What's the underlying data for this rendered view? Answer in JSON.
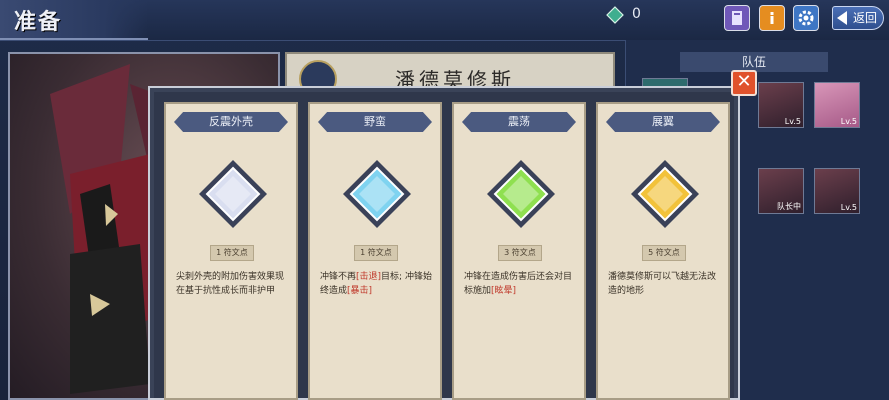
{
  "header": {
    "title": "准备",
    "gem_count": "0",
    "back_label": "返回"
  },
  "name_plate": {
    "name": "潘德莫修斯"
  },
  "team": {
    "label": "队伍",
    "slots": [
      {
        "level": "Lv.5"
      },
      {
        "level": "Lv.5"
      },
      {
        "level": "队长中"
      },
      {
        "level": "Lv.5"
      }
    ]
  },
  "cards": [
    {
      "title": "反震外壳",
      "cost": "1 符文点",
      "desc_parts": [
        "尖刺外壳的附加伤害效果现在基于抗性成长而非护甲"
      ],
      "gem_color": "#d9def0"
    },
    {
      "title": "野蛮",
      "cost": "1 符文点",
      "desc_parts": [
        "冲锋不再",
        "[击退]",
        "目标; 冲锋始终造成",
        "[暴击]"
      ],
      "gem_color": "#7fd3f0"
    },
    {
      "title": "震荡",
      "cost": "3 符文点",
      "desc_parts": [
        "冲锋在造成伤害后还会对目标施加",
        "[眩晕]"
      ],
      "gem_color": "#8fe050"
    },
    {
      "title": "展翼",
      "cost": "5 符文点",
      "desc_parts": [
        "潘德莫修斯可以飞越无法改造的地形"
      ],
      "gem_color": "#f2c23a"
    }
  ],
  "colors": {
    "accent": "#4b5a80",
    "close": "#e0522c",
    "card_bg": "#e9dfcb"
  }
}
